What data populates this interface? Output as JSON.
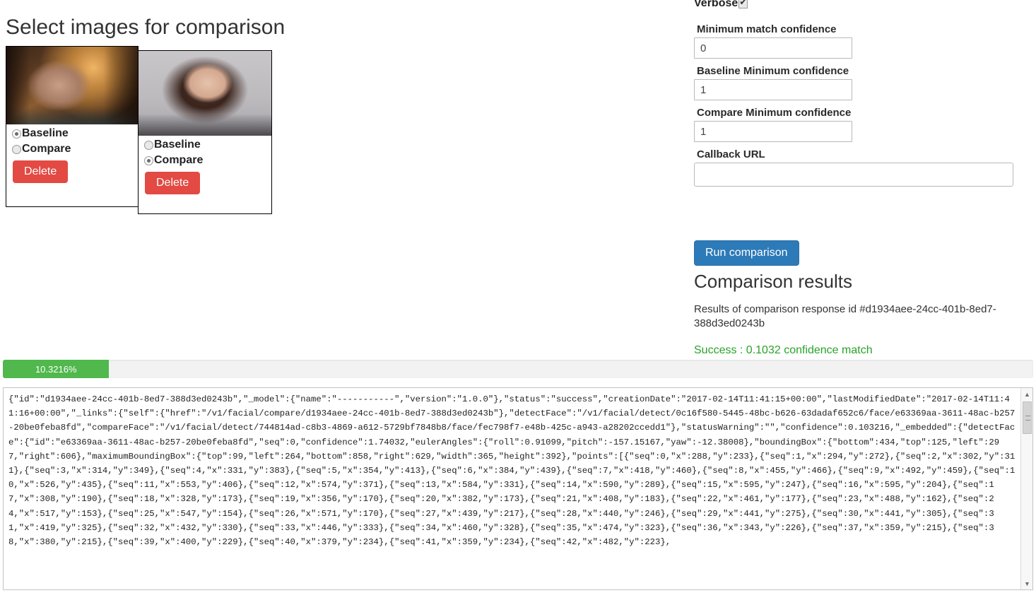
{
  "page_title": "Select images for comparison",
  "image_cards": [
    {
      "photo_alt": "blonde-woman-forest-sunset-photo",
      "baseline_label": "Baseline",
      "compare_label": "Compare",
      "selected": "Baseline",
      "delete_label": "Delete"
    },
    {
      "photo_alt": "brunette-woman-studio-grey-photo",
      "baseline_label": "Baseline",
      "compare_label": "Compare",
      "selected": "Compare",
      "delete_label": "Delete"
    }
  ],
  "form": {
    "verbose_label": "Verbose",
    "verbose_checked": true,
    "min_match_confidence_label": "Minimum match confidence",
    "min_match_confidence_value": "0",
    "baseline_min_confidence_label": "Baseline Minimum confidence",
    "baseline_min_confidence_value": "1",
    "compare_min_confidence_label": "Compare Minimum confidence",
    "compare_min_confidence_value": "1",
    "callback_url_label": "Callback URL",
    "callback_url_value": "",
    "run_button_label": "Run comparison"
  },
  "results": {
    "heading": "Comparison results",
    "subtitle": "Results of comparison response id #d1934aee-24cc-401b-8ed7-388d3ed0243b",
    "status_text": "Success : 0.1032 confidence match",
    "status_color": "#29a329"
  },
  "progress": {
    "label": "10.3216%",
    "percent": 10.3216,
    "bar_color": "#50b84c",
    "track_color": "#f2f2f2"
  },
  "json_output": "{\"id\":\"d1934aee-24cc-401b-8ed7-388d3ed0243b\",\"_model\":{\"name\":\"-----------\",\"version\":\"1.0.0\"},\"status\":\"success\",\"creationDate\":\"2017-02-14T11:41:15+00:00\",\"lastModifiedDate\":\"2017-02-14T11:41:16+00:00\",\"_links\":{\"self\":{\"href\":\"/v1/facial/compare/d1934aee-24cc-401b-8ed7-388d3ed0243b\"},\"detectFace\":\"/v1/facial/detect/0c16f580-5445-48bc-b626-63dadaf652c6/face/e63369aa-3611-48ac-b257-20be0feba8fd\",\"compareFace\":\"/v1/facial/detect/744814ad-c8b3-4869-a612-5729bf7848b8/face/fec798f7-e48b-425c-a943-a28202ccedd1\"},\"statusWarning\":\"\",\"confidence\":0.103216,\"_embedded\":{\"detectFace\":{\"id\":\"e63369aa-3611-48ac-b257-20be0feba8fd\",\"seq\":0,\"confidence\":1.74032,\"eulerAngles\":{\"roll\":0.91099,\"pitch\":-157.15167,\"yaw\":-12.38008},\"boundingBox\":{\"bottom\":434,\"top\":125,\"left\":297,\"right\":606},\"maximumBoundingBox\":{\"top\":99,\"left\":264,\"bottom\":858,\"right\":629,\"width\":365,\"height\":392},\"points\":[{\"seq\":0,\"x\":288,\"y\":233},{\"seq\":1,\"x\":294,\"y\":272},{\"seq\":2,\"x\":302,\"y\":311},{\"seq\":3,\"x\":314,\"y\":349},{\"seq\":4,\"x\":331,\"y\":383},{\"seq\":5,\"x\":354,\"y\":413},{\"seq\":6,\"x\":384,\"y\":439},{\"seq\":7,\"x\":418,\"y\":460},{\"seq\":8,\"x\":455,\"y\":466},{\"seq\":9,\"x\":492,\"y\":459},{\"seq\":10,\"x\":526,\"y\":435},{\"seq\":11,\"x\":553,\"y\":406},{\"seq\":12,\"x\":574,\"y\":371},{\"seq\":13,\"x\":584,\"y\":331},{\"seq\":14,\"x\":590,\"y\":289},{\"seq\":15,\"x\":595,\"y\":247},{\"seq\":16,\"x\":595,\"y\":204},{\"seq\":17,\"x\":308,\"y\":190},{\"seq\":18,\"x\":328,\"y\":173},{\"seq\":19,\"x\":356,\"y\":170},{\"seq\":20,\"x\":382,\"y\":173},{\"seq\":21,\"x\":408,\"y\":183},{\"seq\":22,\"x\":461,\"y\":177},{\"seq\":23,\"x\":488,\"y\":162},{\"seq\":24,\"x\":517,\"y\":153},{\"seq\":25,\"x\":547,\"y\":154},{\"seq\":26,\"x\":571,\"y\":170},{\"seq\":27,\"x\":439,\"y\":217},{\"seq\":28,\"x\":440,\"y\":246},{\"seq\":29,\"x\":441,\"y\":275},{\"seq\":30,\"x\":441,\"y\":305},{\"seq\":31,\"x\":419,\"y\":325},{\"seq\":32,\"x\":432,\"y\":330},{\"seq\":33,\"x\":446,\"y\":333},{\"seq\":34,\"x\":460,\"y\":328},{\"seq\":35,\"x\":474,\"y\":323},{\"seq\":36,\"x\":343,\"y\":226},{\"seq\":37,\"x\":359,\"y\":215},{\"seq\":38,\"x\":380,\"y\":215},{\"seq\":39,\"x\":400,\"y\":229},{\"seq\":40,\"x\":379,\"y\":234},{\"seq\":41,\"x\":359,\"y\":234},{\"seq\":42,\"x\":482,\"y\":223},",
  "scrollbar": {
    "up_icon": "▲",
    "down_icon": "▼"
  }
}
